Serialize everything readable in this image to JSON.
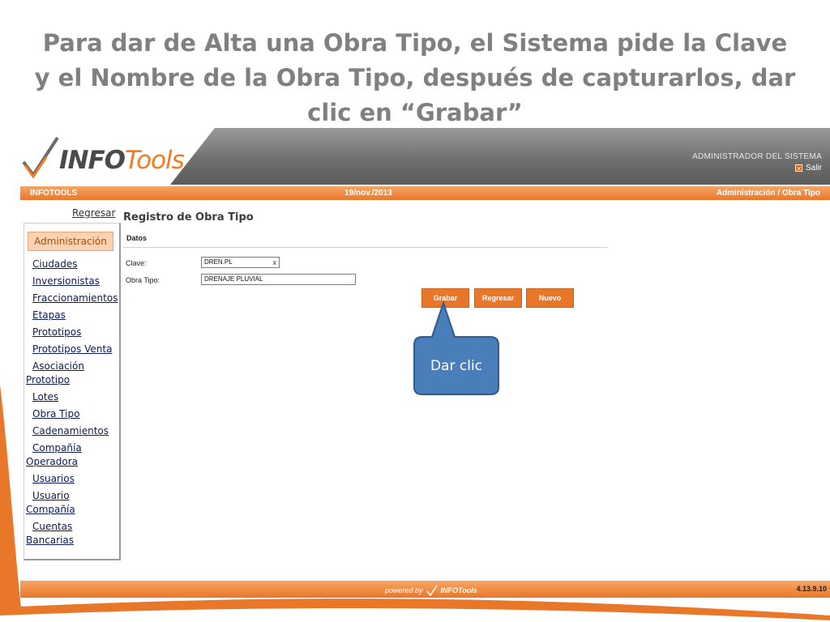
{
  "slide": {
    "title": "Para dar de Alta una Obra Tipo, el Sistema pide la Clave y el Nombre de la Obra Tipo, después de capturarlos, dar clic en “Grabar”"
  },
  "header": {
    "logo_main": "INFO",
    "logo_accent": "Tools",
    "user_role": "ADMINISTRADOR DEL SISTEMA",
    "logout_label": "Salir"
  },
  "topbar": {
    "app_name": "INFOTOOLS",
    "date": "19/nov./2013",
    "breadcrumb": "Administración / Obra Tipo"
  },
  "sidebar": {
    "back_link": "Regresar",
    "section": "Administración",
    "items": [
      "Ciudades",
      "Inversionistas",
      "Fraccionamientos",
      "Etapas",
      "Prototipos",
      "Prototipos Venta",
      "Asociación Prototipo",
      "Lotes",
      "Obra Tipo",
      "Cadenamientos",
      "Compañía Operadora",
      "Usuarios",
      "Usuario Compañía",
      "Cuentas Bancarias"
    ]
  },
  "form": {
    "title": "Registro de Obra Tipo",
    "section": "Datos",
    "clave_label": "Clave:",
    "clave_value": "DREN.PL",
    "clear_glyph": "x",
    "obra_label": "Obra Tipo:",
    "obra_value": "DRENAJE PLUVIAL"
  },
  "buttons": {
    "save": "Grabar",
    "back": "Regresar",
    "new": "Nuevo"
  },
  "callout": {
    "text": "Dar clic"
  },
  "footer": {
    "powered_by": "powered by",
    "brand": "INFOTools",
    "version": "4.13.9.10"
  },
  "colors": {
    "orange": "#e9772a",
    "callout_blue": "#4a7ebb",
    "title_gray": "#808080"
  }
}
